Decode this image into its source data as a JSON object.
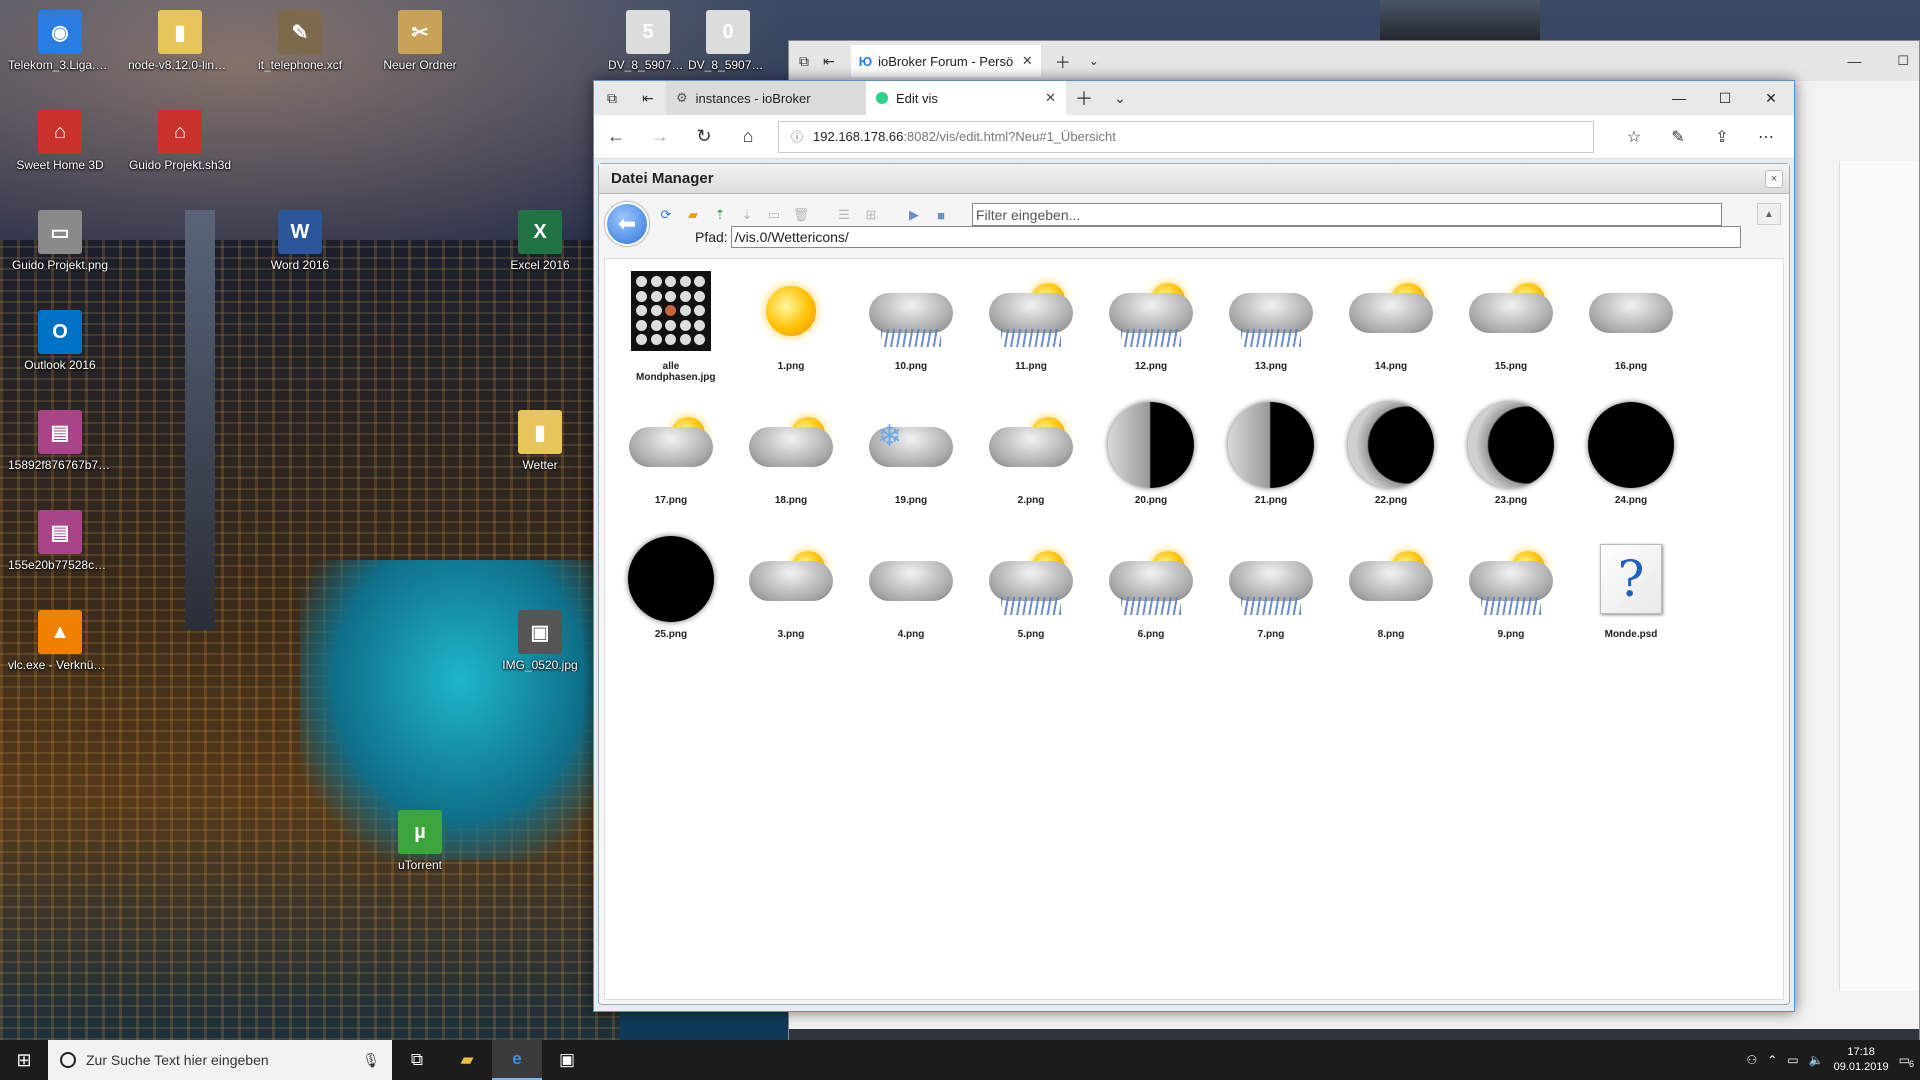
{
  "desktop": {
    "icons": [
      {
        "label": "Telekom_3.Liga.m3u",
        "glyph": "◉",
        "color": "#2a7de1"
      },
      {
        "label": "node-v8.12.0-linux-...",
        "glyph": "▮",
        "color": "#e7c55a"
      },
      {
        "label": "it_telephone.xcf",
        "glyph": "✎",
        "color": "#7d6a4c"
      },
      {
        "label": "Neuer Ordner",
        "glyph": "✂",
        "color": "#c9a25a"
      },
      {
        "label": "Sweet Home 3D",
        "glyph": "⌂",
        "color": "#c8322a"
      },
      {
        "label": "Guido Projekt.sh3d",
        "glyph": "⌂",
        "color": "#c8322a"
      },
      {
        "label": "Guido Projekt.png",
        "glyph": "▭",
        "color": "#8a8a8a"
      },
      {
        "label": "Word 2016",
        "glyph": "W",
        "color": "#2b579a"
      },
      {
        "label": "Excel 2016",
        "glyph": "X",
        "color": "#217346"
      },
      {
        "label": "Outlook 2016",
        "glyph": "O",
        "color": "#0072c6"
      },
      {
        "label": "15892f876767b7.jpg",
        "glyph": "▤",
        "color": "#a48"
      },
      {
        "label": "Wetter",
        "glyph": "▮",
        "color": "#e7c55a"
      },
      {
        "label": "155e20b77528c1_72...",
        "glyph": "▤",
        "color": "#a48"
      },
      {
        "label": "vlc.exe - Verknüpfung",
        "glyph": "▲",
        "color": "#f08000"
      },
      {
        "label": "IMG_0520.jpg",
        "glyph": "▣",
        "color": "#555"
      },
      {
        "label": "uTorrent",
        "glyph": "µ",
        "color": "#3ca63c"
      },
      {
        "label": "DV_8_5907625_01_4c...",
        "glyph": "5",
        "color": "#dcdcdc"
      },
      {
        "label": "DV_8_590762...",
        "glyph": "0",
        "color": "#dcdcdc"
      }
    ]
  },
  "bg_browser": {
    "tab_title": "ioBroker Forum - Persö"
  },
  "browser": {
    "tabs": [
      {
        "title": "instances - ioBroker"
      },
      {
        "title": "Edit vis"
      }
    ],
    "url_host": "192.168.178.66",
    "url_path": ":8082/vis/edit.html?Neu#1_Übersicht"
  },
  "file_manager": {
    "title": "Datei Manager",
    "close_label": "×",
    "filter_placeholder": "Filter eingeben...",
    "path_label": "Pfad:",
    "path_value": "/vis.0/Wettericons/",
    "files": [
      {
        "name": "alle Mondphasen.jpg",
        "kind": "phases"
      },
      {
        "name": "1.png",
        "kind": "sun"
      },
      {
        "name": "10.png",
        "kind": "cloud-rain"
      },
      {
        "name": "11.png",
        "kind": "sun-cloud-rain"
      },
      {
        "name": "12.png",
        "kind": "sun-cloud-rain"
      },
      {
        "name": "13.png",
        "kind": "cloud-rain"
      },
      {
        "name": "14.png",
        "kind": "sun-cloud"
      },
      {
        "name": "15.png",
        "kind": "sun-cloud"
      },
      {
        "name": "16.png",
        "kind": "cloud"
      },
      {
        "name": "17.png",
        "kind": "sun-cloud"
      },
      {
        "name": "18.png",
        "kind": "sun-cloud"
      },
      {
        "name": "19.png",
        "kind": "snow"
      },
      {
        "name": "2.png",
        "kind": "sun-cloud"
      },
      {
        "name": "20.png",
        "kind": "moon-half"
      },
      {
        "name": "21.png",
        "kind": "moon-half"
      },
      {
        "name": "22.png",
        "kind": "moon-crescent"
      },
      {
        "name": "23.png",
        "kind": "moon-crescent"
      },
      {
        "name": "24.png",
        "kind": "moon-new"
      },
      {
        "name": "25.png",
        "kind": "moon-new"
      },
      {
        "name": "3.png",
        "kind": "sun-cloud"
      },
      {
        "name": "4.png",
        "kind": "cloud"
      },
      {
        "name": "5.png",
        "kind": "sun-cloud-rain"
      },
      {
        "name": "6.png",
        "kind": "sun-cloud-rain"
      },
      {
        "name": "7.png",
        "kind": "cloud-rain"
      },
      {
        "name": "8.png",
        "kind": "sun-cloud"
      },
      {
        "name": "9.png",
        "kind": "sun-cloud-rain"
      },
      {
        "name": "Monde.psd",
        "kind": "psd"
      }
    ]
  },
  "taskbar": {
    "search_placeholder": "Zur Suche Text hier eingeben",
    "time": "17:18",
    "date": "09.01.2019",
    "notifications": "6"
  },
  "colors": {
    "accent": "#2f74d8",
    "taskbar_bg": "#1c1c1c"
  }
}
